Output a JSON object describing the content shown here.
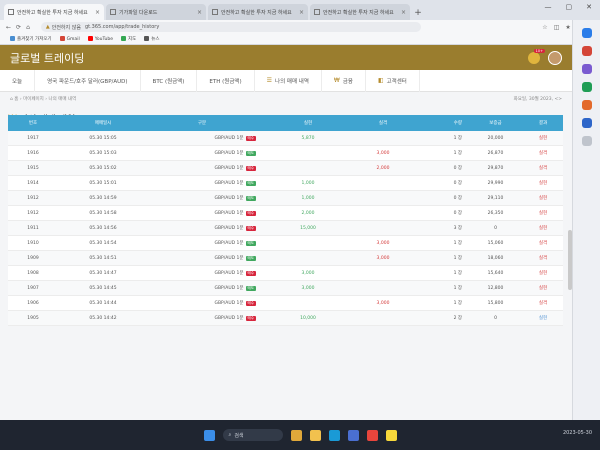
{
  "browser": {
    "tabs": [
      {
        "label": "안전하고 확실한 투자 지금 하세요"
      },
      {
        "label": "기가파일 다운로드"
      },
      {
        "label": "안전하고 확실한 투자 지금 하세요"
      },
      {
        "label": "안전하고 확실한 투자 지금 하세요"
      }
    ],
    "new_tab": "+",
    "security_label": "안전하지 않음",
    "url": "gt.365.com/app/trade_history",
    "bookmarks": [
      "즐겨찾기 가져오기",
      "Gmail",
      "YouTube",
      "지도",
      "뉴스"
    ],
    "bookmark_colors": [
      "#4a8ed1",
      "#d44638",
      "#ff0000",
      "#34a853",
      "#555555"
    ]
  },
  "header": {
    "title": "글로벌 트레이딩",
    "notification_count": "10+"
  },
  "menu": {
    "items": [
      {
        "label": "오늘",
        "glyph": ""
      },
      {
        "label": "영국 파운드/호주 달러(GBP/AUD)",
        "glyph": ""
      },
      {
        "label": "BTC (원금액)",
        "glyph": ""
      },
      {
        "label": "ETH (원금액)",
        "glyph": ""
      },
      {
        "label": "나의 매매 내역",
        "glyph": "☰"
      },
      {
        "label": "금융",
        "glyph": "₩"
      },
      {
        "label": "고객센터",
        "glyph": "◧"
      }
    ]
  },
  "breadcrumb": {
    "home": "홈",
    "section": "마이페이지",
    "current": "나의 매매 내역",
    "date": "화요일, 30월 2023, <>"
  },
  "page": {
    "title": "나의 매매 내역",
    "subtitle": "매매 내역"
  },
  "table": {
    "headers": [
      "번호",
      "매매일시",
      "구분",
      "실현",
      "실격",
      "수량",
      "보증금",
      "결과"
    ],
    "rows": [
      {
        "no": "1917",
        "time": "05.30 15:05",
        "type": "GBP/AUD 1분",
        "tag": "매수",
        "tag_color": "#d7263d",
        "gain": "5,870",
        "loss": "",
        "qty": "1 장",
        "deposit": "20,000",
        "result": "실현",
        "result_color": "red"
      },
      {
        "no": "1916",
        "time": "05.30 15:03",
        "type": "GBP/AUD 1분",
        "tag": "매도",
        "tag_color": "#41a85f",
        "gain": "",
        "loss": "3,000",
        "qty": "1 장",
        "deposit": "26,870",
        "result": "실격",
        "result_color": "red"
      },
      {
        "no": "1915",
        "time": "05.30 15:02",
        "type": "GBP/AUD 1분",
        "tag": "매수",
        "tag_color": "#d7263d",
        "gain": "",
        "loss": "2,000",
        "qty": "0 장",
        "deposit": "29,870",
        "result": "실격",
        "result_color": "red"
      },
      {
        "no": "1914",
        "time": "05.30 15:01",
        "type": "GBP/AUD 1분",
        "tag": "매도",
        "tag_color": "#41a85f",
        "gain": "1,000",
        "loss": "",
        "qty": "0 장",
        "deposit": "29,990",
        "result": "실현",
        "result_color": "red"
      },
      {
        "no": "1912",
        "time": "05.30 14:59",
        "type": "GBP/AUD 1분",
        "tag": "매도",
        "tag_color": "#41a85f",
        "gain": "1,000",
        "loss": "",
        "qty": "0 장",
        "deposit": "29,110",
        "result": "실현",
        "result_color": "red"
      },
      {
        "no": "1912",
        "time": "05.30 14:58",
        "type": "GBP/AUD 1분",
        "tag": "매수",
        "tag_color": "#d7263d",
        "gain": "2,000",
        "loss": "",
        "qty": "0 장",
        "deposit": "26,350",
        "result": "실현",
        "result_color": "red"
      },
      {
        "no": "1911",
        "time": "05.30 14:56",
        "type": "GBP/AUD 1분",
        "tag": "매수",
        "tag_color": "#d7263d",
        "gain": "15,000",
        "loss": "",
        "qty": "3 장",
        "deposit": "0",
        "result": "실현",
        "result_color": "red"
      },
      {
        "no": "1910",
        "time": "05.30 14:54",
        "type": "GBP/AUD 1분",
        "tag": "매도",
        "tag_color": "#41a85f",
        "gain": "",
        "loss": "3,000",
        "qty": "1 장",
        "deposit": "15,060",
        "result": "실격",
        "result_color": "red"
      },
      {
        "no": "1909",
        "time": "05.30 14:51",
        "type": "GBP/AUD 1분",
        "tag": "매도",
        "tag_color": "#41a85f",
        "gain": "",
        "loss": "3,000",
        "qty": "1 장",
        "deposit": "18,060",
        "result": "실격",
        "result_color": "red"
      },
      {
        "no": "1908",
        "time": "05.30 14:47",
        "type": "GBP/AUD 1분",
        "tag": "매수",
        "tag_color": "#d7263d",
        "gain": "3,000",
        "loss": "",
        "qty": "1 장",
        "deposit": "15,640",
        "result": "실현",
        "result_color": "red"
      },
      {
        "no": "1907",
        "time": "05.30 14:45",
        "type": "GBP/AUD 1분",
        "tag": "매도",
        "tag_color": "#41a85f",
        "gain": "3,000",
        "loss": "",
        "qty": "1 장",
        "deposit": "12,800",
        "result": "실현",
        "result_color": "red"
      },
      {
        "no": "1906",
        "time": "05.30 14:44",
        "type": "GBP/AUD 1분",
        "tag": "매수",
        "tag_color": "#d7263d",
        "gain": "",
        "loss": "3,000",
        "qty": "1 장",
        "deposit": "15,800",
        "result": "실격",
        "result_color": "red"
      },
      {
        "no": "1905",
        "time": "05.30 14:42",
        "type": "GBP/AUD 1분",
        "tag": "매수",
        "tag_color": "#d7263d",
        "gain": "10,000",
        "loss": "",
        "qty": "2 장",
        "deposit": "0",
        "result": "실현",
        "result_color": "blue"
      }
    ]
  },
  "taskbar": {
    "search_label": "검색",
    "tray": "2023-05-30"
  }
}
